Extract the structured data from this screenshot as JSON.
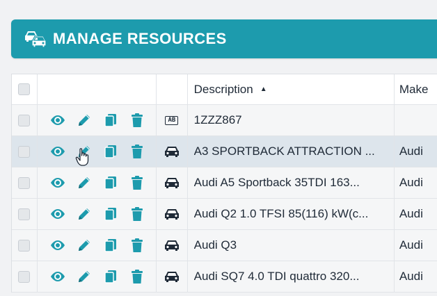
{
  "header": {
    "title": "MANAGE RESOURCES",
    "icon": "cars-icon",
    "color": "#1d9bad"
  },
  "table": {
    "columns": [
      "Description",
      "Make"
    ],
    "sort": {
      "column": "Description",
      "direction": "ascending"
    },
    "action_icons": [
      "eye-icon",
      "pencil-icon",
      "copy-icon",
      "trash-icon"
    ],
    "action_color": "#1d9bad",
    "rows": [
      {
        "type_icon": "plate-icon",
        "type_label": "AB",
        "description": "1ZZZ867",
        "make": ""
      },
      {
        "type_icon": "car-icon",
        "description": "A3 SPORTBACK ATTRACTION ...",
        "make": "Audi",
        "hovered": true
      },
      {
        "type_icon": "car-icon",
        "description": "Audi A5 Sportback 35TDI 163...",
        "make": "Audi"
      },
      {
        "type_icon": "car-icon",
        "description": "Audi Q2 1.0 TFSI 85(116) kW(c...",
        "make": "Audi"
      },
      {
        "type_icon": "car-icon",
        "description": "Audi Q3",
        "make": "Audi"
      },
      {
        "type_icon": "car-icon",
        "description": "Audi SQ7 4.0 TDI quattro 320...",
        "make": "Audi"
      }
    ]
  }
}
